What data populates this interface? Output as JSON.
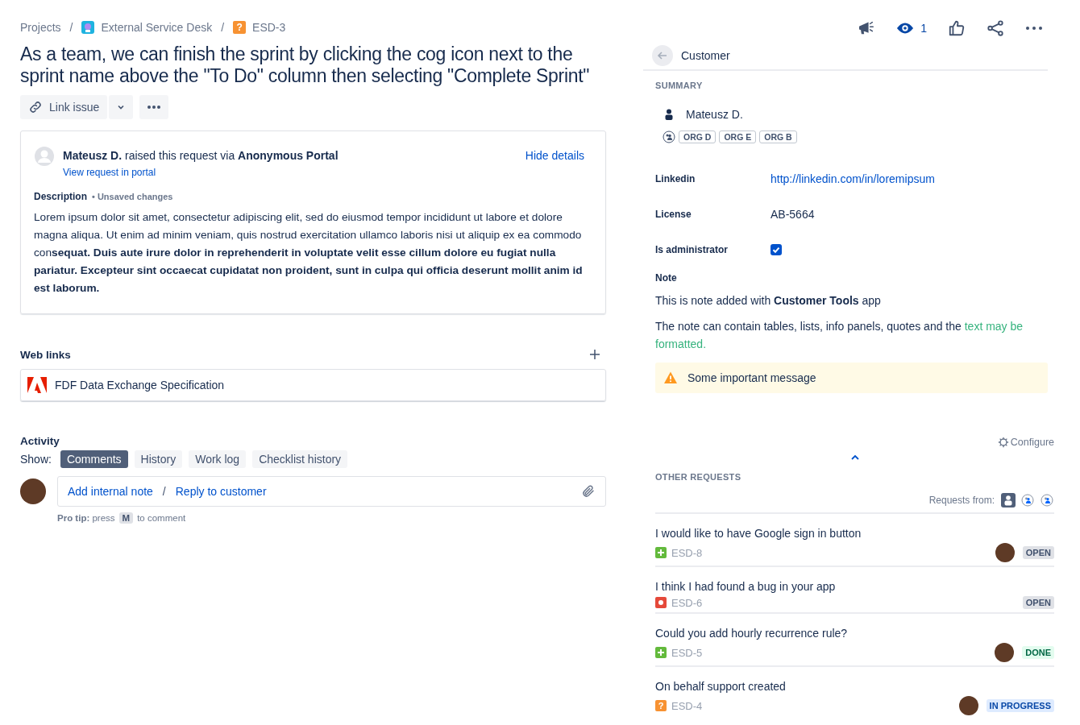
{
  "breadcrumbs": [
    {
      "label": "Projects",
      "kind": "text"
    },
    {
      "label": "External Service Desk",
      "kind": "project",
      "separator": "/"
    },
    {
      "label": "ESD-3",
      "kind": "issue",
      "separator": "/",
      "icon": "?"
    }
  ],
  "title": "As a team, we can finish the sprint by clicking the cog icon next to the sprint name above the \"To Do\" column then selecting \"Complete Sprint\"",
  "link_issue": "Link issue",
  "watchers": "1",
  "request": {
    "reporter": "Mateusz D.",
    "via": "raised this request via",
    "portal": "Anonymous Portal",
    "portal_link": "View request in portal",
    "hide": "Hide details",
    "description_label": "Description",
    "unsaved": "• Unsaved changes",
    "description": "Lorem ipsum dolor sit amet, consectetur adipiscing elit, sed do eiusmod tempor incididunt ut labore et dolore magna aliqua. Ut enim ad minim veniam, quis nostrud exercitation ullamco laboris nisi ut aliquip ex ea commodo con**sequat. Duis aute irure dolor in reprehenderit in voluptate velit esse cillum dolore eu fugiat nulla pariatur. Excepteur sint occaecat cupidatat non proident, sunt in culpa qui officia deserunt mollit anim id est laborum.**"
  },
  "web_links": {
    "title": "Web links",
    "items": [
      {
        "label": "FDF Data Exchange Specification"
      }
    ]
  },
  "activity": {
    "title": "Activity",
    "show": "Show:",
    "filters": [
      {
        "label": "Comments",
        "selected": true
      },
      {
        "label": "History",
        "selected": false
      },
      {
        "label": "Work log",
        "selected": false
      },
      {
        "label": "Checklist history",
        "selected": false
      }
    ],
    "internal_note": "Add internal note",
    "separator": "/",
    "reply": "Reply to customer",
    "tip_label": "Pro tip:",
    "tip_press": "press",
    "tip_key": "M",
    "tip_end": "to comment"
  },
  "customer": {
    "title": "Customer",
    "summary": "SUMMARY",
    "name": "Mateusz D.",
    "orgs": [
      "ORG D",
      "ORG E",
      "ORG B"
    ],
    "fields": [
      {
        "label": "Linkedin",
        "kind": "link",
        "value": "http://linkedin.com/in/loremipsum"
      },
      {
        "label": "License",
        "kind": "text",
        "value": "AB-5664"
      },
      {
        "label": "Is administrator",
        "kind": "checkbox",
        "checked": true
      }
    ],
    "note_label": "Note",
    "note_lines": [
      {
        "text": "This is note added with **Customer Tools** app"
      },
      {
        "text": "The note can contain tables, lists, info panels, quotes and the ",
        "highlight": "text may be formatted."
      }
    ],
    "warning": "Some important message",
    "configure": "Configure"
  },
  "other_requests": {
    "title": "OTHER REQUESTS",
    "from": "Requests from:",
    "filters": [
      {
        "kind": "person",
        "selected": true
      },
      {
        "kind": "org",
        "selected": false
      },
      {
        "kind": "org",
        "selected": false
      }
    ],
    "items": [
      {
        "summary": "I would like to have Google sign in button",
        "key": "ESD-8",
        "kind": "story",
        "avatar": true,
        "status": "OPEN",
        "color": "#dfe1e6"
      },
      {
        "summary": "I think I had found a bug in your app",
        "key": "ESD-6",
        "kind": "bug",
        "avatar": false,
        "status": "OPEN",
        "color": "#dfe1e6"
      },
      {
        "summary": "Could you add hourly recurrence rule?",
        "key": "ESD-5",
        "kind": "story",
        "avatar": true,
        "status": "DONE",
        "color": "#e3fcef"
      },
      {
        "summary": "On behalf support created",
        "key": "ESD-4",
        "kind": "question",
        "icon": "?",
        "avatar": true,
        "status": "IN PROGRESS",
        "color": "#deebff"
      }
    ]
  }
}
